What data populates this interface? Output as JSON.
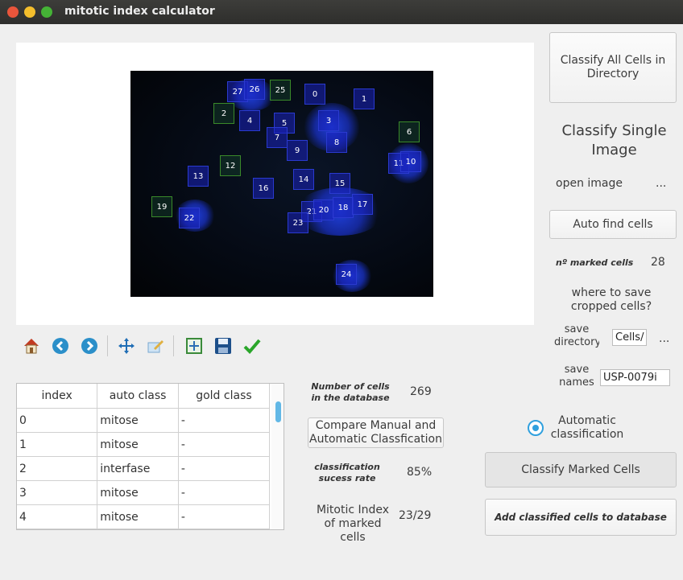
{
  "window": {
    "title": "mitotic index calculator"
  },
  "cells": [
    {
      "label": "27",
      "green": false
    },
    {
      "label": "26",
      "green": false
    },
    {
      "label": "25",
      "green": true
    },
    {
      "label": "0",
      "green": false
    },
    {
      "label": "1",
      "green": false
    },
    {
      "label": "2",
      "green": true
    },
    {
      "label": "4",
      "green": false
    },
    {
      "label": "5",
      "green": false
    },
    {
      "label": "3",
      "green": false
    },
    {
      "label": "6",
      "green": true
    },
    {
      "label": "7",
      "green": false
    },
    {
      "label": "9",
      "green": false
    },
    {
      "label": "8",
      "green": false
    },
    {
      "label": "11",
      "green": false
    },
    {
      "label": "10",
      "green": false
    },
    {
      "label": "13",
      "green": false
    },
    {
      "label": "12",
      "green": true
    },
    {
      "label": "16",
      "green": false
    },
    {
      "label": "14",
      "green": false
    },
    {
      "label": "15",
      "green": false
    },
    {
      "label": "19",
      "green": true
    },
    {
      "label": "22",
      "green": false
    },
    {
      "label": "21",
      "green": false
    },
    {
      "label": "20",
      "green": false
    },
    {
      "label": "18",
      "green": false
    },
    {
      "label": "17",
      "green": false
    },
    {
      "label": "23",
      "green": false
    },
    {
      "label": "24",
      "green": false
    }
  ],
  "toolbar": {
    "icons": [
      "home-icon",
      "back-arrow-icon",
      "forward-arrow-icon",
      "pan-icon",
      "edit-axes-icon",
      "subplots-icon",
      "save-icon",
      "check-icon"
    ]
  },
  "table": {
    "headers": [
      "index",
      "auto class",
      "gold class"
    ],
    "rows": [
      [
        "0",
        "mitose",
        "-"
      ],
      [
        "1",
        "mitose",
        "-"
      ],
      [
        "2",
        "interfase",
        "-"
      ],
      [
        "3",
        "mitose",
        "-"
      ],
      [
        "4",
        "mitose",
        "-"
      ],
      [
        "",
        "",
        ""
      ]
    ]
  },
  "stats": {
    "cells_db_label": "Number of cells in the database",
    "cells_db_value": "269",
    "compare_button": "Compare Manual and Automatic Classfication",
    "success_label": "classification sucess rate",
    "success_value": "85%",
    "mitotic_label": "Mitotic Index of marked cells",
    "mitotic_value": "23/29"
  },
  "right": {
    "classify_all_button": "Classify All Cells in Directory",
    "single_title": "Classify Single Image",
    "open_image_label": "open image",
    "open_image_browse": "...",
    "auto_find_button": "Auto find cells",
    "marked_label": "nº marked cells",
    "marked_value": "28",
    "where_save_label": "where to save cropped cells?",
    "save_dir_label": "save directory",
    "save_dir_value": "Cells/",
    "save_dir_browse": "...",
    "save_names_label": "save names",
    "save_names_value": "USP-0079i",
    "auto_radio_label": "Automatic classification",
    "classify_marked_button": "Classify Marked Cells",
    "add_db_button": "Add classified cells to database"
  }
}
